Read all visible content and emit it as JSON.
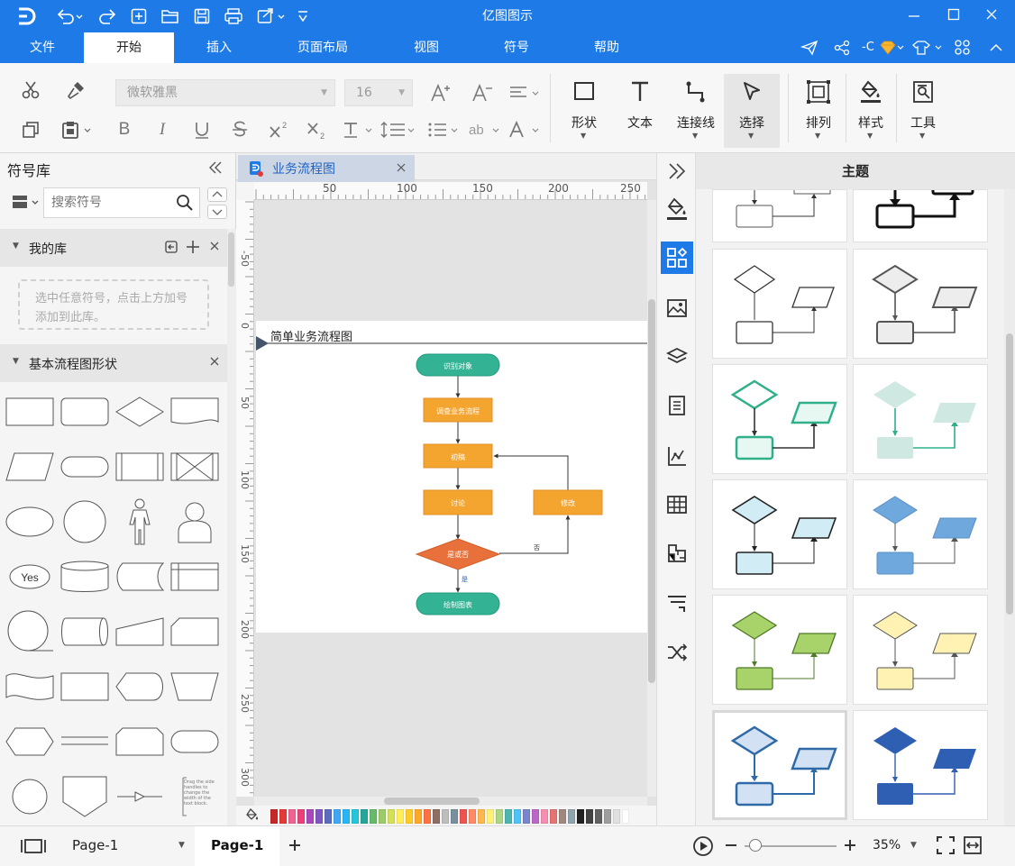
{
  "app": {
    "title": "亿图图示"
  },
  "menu": {
    "tabs": [
      "文件",
      "开始",
      "插入",
      "页面布局",
      "视图",
      "符号",
      "帮助"
    ],
    "active": "开始",
    "user_label": "-C"
  },
  "ribbon": {
    "font_name": "微软雅黑",
    "font_size": "16",
    "big_buttons": [
      {
        "id": "shape",
        "label": "形状",
        "icon": "rectangle-icon"
      },
      {
        "id": "text",
        "label": "文本",
        "icon": "text-icon"
      },
      {
        "id": "connector",
        "label": "连接线",
        "icon": "connector-icon"
      },
      {
        "id": "select",
        "label": "选择",
        "icon": "pointer-icon"
      },
      {
        "id": "arrange",
        "label": "排列",
        "icon": "arrange-icon"
      },
      {
        "id": "style",
        "label": "样式",
        "icon": "fill-bucket-icon"
      },
      {
        "id": "tools",
        "label": "工具",
        "icon": "tools-icon"
      }
    ]
  },
  "library": {
    "title": "符号库",
    "search_placeholder": "搜索符号",
    "my_library": {
      "title": "我的库",
      "hint": "选中任意符号，点击上方加号添加到此库。"
    },
    "basic_flowchart": {
      "title": "基本流程图形状"
    },
    "yes_label": "Yes",
    "text_block_hint": "Drag the side handles to change the width of the text block."
  },
  "document": {
    "tab_title": "业务流程图",
    "ruler_h": [
      "50",
      "100",
      "150",
      "200",
      "250"
    ],
    "ruler_v": [
      "-50",
      "0",
      "50",
      "100",
      "150",
      "200",
      "250",
      "300"
    ],
    "diagram_title": "简单业务流程图",
    "nodes": {
      "start": "识别对象",
      "investigate": "调查业务流程",
      "draft": "初稿",
      "discuss": "讨论",
      "modify": "修改",
      "decision": "是或否",
      "end": "绘制图表"
    },
    "edge_labels": {
      "no": "否",
      "yes": "是"
    }
  },
  "theme_panel": {
    "title": "主题"
  },
  "palette": [
    "#c62828",
    "#e53935",
    "#f06292",
    "#ec407a",
    "#ab47bc",
    "#7e57c2",
    "#5c6bc0",
    "#42a5f5",
    "#29b6f6",
    "#26c6da",
    "#26a69a",
    "#66bb6a",
    "#9ccc65",
    "#d4e157",
    "#ffee58",
    "#ffca28",
    "#ffa726",
    "#ff7043",
    "#8d6e63",
    "#bdbdbd",
    "#78909c",
    "#ef5350",
    "#ff8a65",
    "#ffb74d",
    "#fff176",
    "#aed581",
    "#4db6ac",
    "#4fc3f7",
    "#7986cb",
    "#ba68c8",
    "#f48fb1",
    "#e57373",
    "#a1887f",
    "#90a4ae",
    "#212121",
    "#424242",
    "#616161",
    "#9e9e9e",
    "#e0e0e0",
    "#ffffff"
  ],
  "status": {
    "page_select": "Page-1",
    "page_tab": "Page-1",
    "zoom": "35%"
  }
}
